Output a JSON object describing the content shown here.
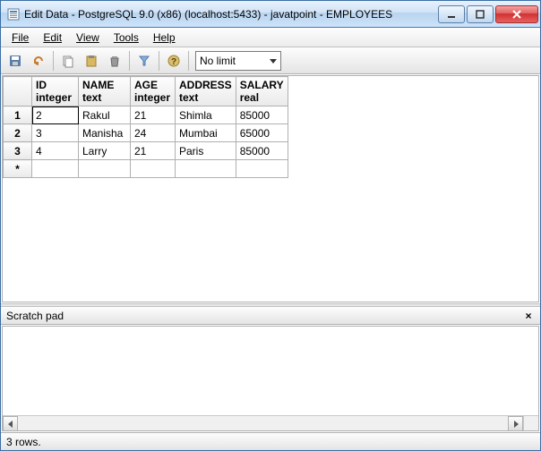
{
  "titlebar": {
    "text": "Edit Data - PostgreSQL 9.0 (x86) (localhost:5433) - javatpoint - EMPLOYEES"
  },
  "menu": {
    "file": "File",
    "edit": "Edit",
    "view": "View",
    "tools": "Tools",
    "help": "Help"
  },
  "toolbar": {
    "limit_value": "No limit"
  },
  "grid": {
    "columns": [
      {
        "name": "ID",
        "type": "integer"
      },
      {
        "name": "NAME",
        "type": "text"
      },
      {
        "name": "AGE",
        "type": "integer"
      },
      {
        "name": "ADDRESS",
        "type": "text"
      },
      {
        "name": "SALARY",
        "type": "real"
      }
    ],
    "rows": [
      {
        "n": "1",
        "id": "2",
        "name": "Rakul",
        "age": "21",
        "address": "Shimla",
        "salary": "85000"
      },
      {
        "n": "2",
        "id": "3",
        "name": "Manisha",
        "age": "24",
        "address": "Mumbai",
        "salary": "65000"
      },
      {
        "n": "3",
        "id": "4",
        "name": "Larry",
        "age": "21",
        "address": "Paris",
        "salary": "85000"
      }
    ],
    "new_row_marker": "*",
    "active_cell": {
      "row": 0,
      "col": "id"
    }
  },
  "scratch": {
    "title": "Scratch pad",
    "close": "×"
  },
  "status": {
    "text": "3 rows."
  },
  "colors": {
    "close_button": "#d03030",
    "titlebar_gradient_top": "#e8f1fb",
    "titlebar_gradient_bottom": "#cde3f8"
  }
}
